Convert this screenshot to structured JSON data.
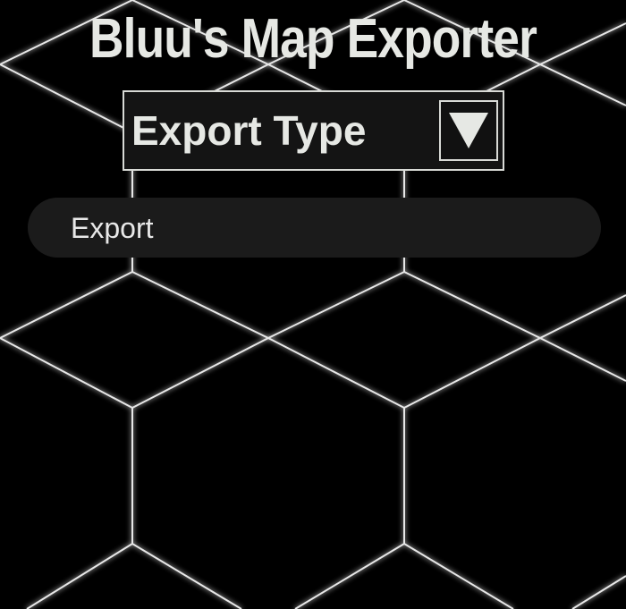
{
  "app": {
    "title": "Bluu's Map Exporter",
    "background_color": "#000000",
    "pattern_line_color": "#e8e8e8"
  },
  "export_type_dropdown": {
    "label": "Export Type",
    "arrow_icon": "triangle-down-icon"
  },
  "export_button": {
    "label": "Export"
  },
  "icons": {
    "background": "hexagon-pattern"
  }
}
